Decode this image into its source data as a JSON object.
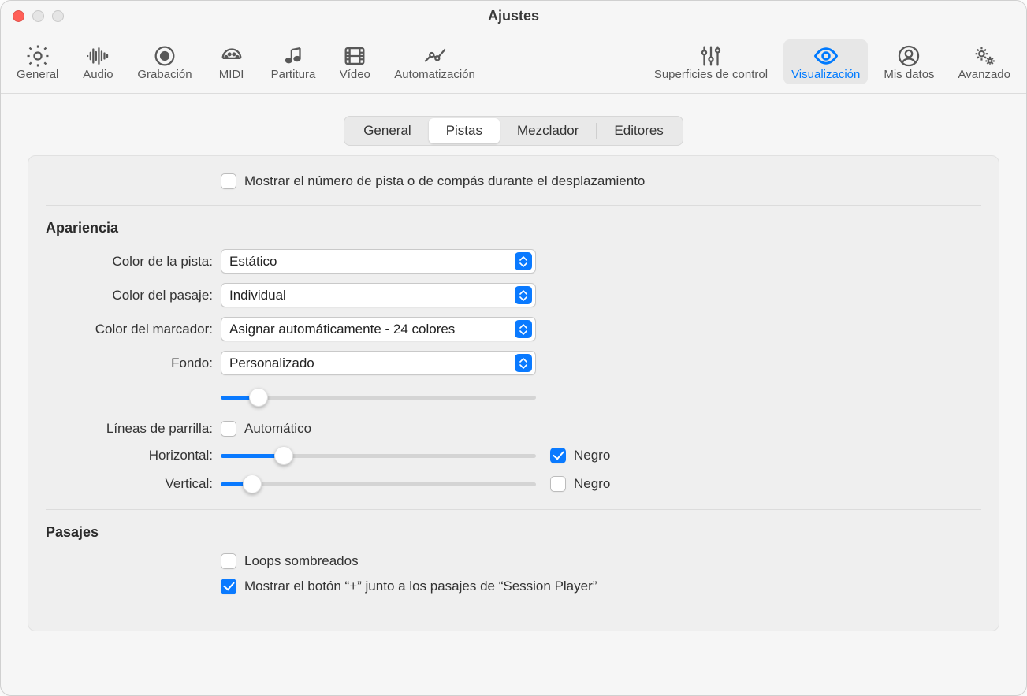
{
  "window": {
    "title": "Ajustes"
  },
  "toolbar": {
    "general": "General",
    "audio": "Audio",
    "grabacion": "Grabación",
    "midi": "MIDI",
    "partitura": "Partitura",
    "video": "Vídeo",
    "automatizacion": "Automatización",
    "superficies": "Superficies de control",
    "visualizacion": "Visualización",
    "misdatos": "Mis datos",
    "avanzado": "Avanzado"
  },
  "subtabs": {
    "general": "General",
    "pistas": "Pistas",
    "mezclador": "Mezclador",
    "editores": "Editores"
  },
  "checkboxes": {
    "mostrar_num": "Mostrar el número de pista o de compás durante el desplazamiento",
    "automatico": "Automático",
    "negro_h": "Negro",
    "negro_v": "Negro",
    "loops": "Loops sombreados",
    "mostrar_mas": "Mostrar el botón “+” junto a los pasajes de “Session Player”"
  },
  "sections": {
    "apariencia": "Apariencia",
    "pasajes": "Pasajes"
  },
  "labels": {
    "color_pista": "Color de la pista:",
    "color_pasaje": "Color del pasaje:",
    "color_marcador": "Color del marcador:",
    "fondo": "Fondo:",
    "lineas": "Líneas de parrilla:",
    "horizontal": "Horizontal:",
    "vertical": "Vertical:"
  },
  "selects": {
    "color_pista": "Estático",
    "color_pasaje": "Individual",
    "color_marcador": "Asignar automáticamente - 24 colores",
    "fondo": "Personalizado"
  },
  "sliders": {
    "fondo": 12,
    "horizontal": 20,
    "vertical": 10
  },
  "state": {
    "negro_h_checked": true,
    "negro_v_checked": false,
    "mostrar_mas_checked": true
  }
}
